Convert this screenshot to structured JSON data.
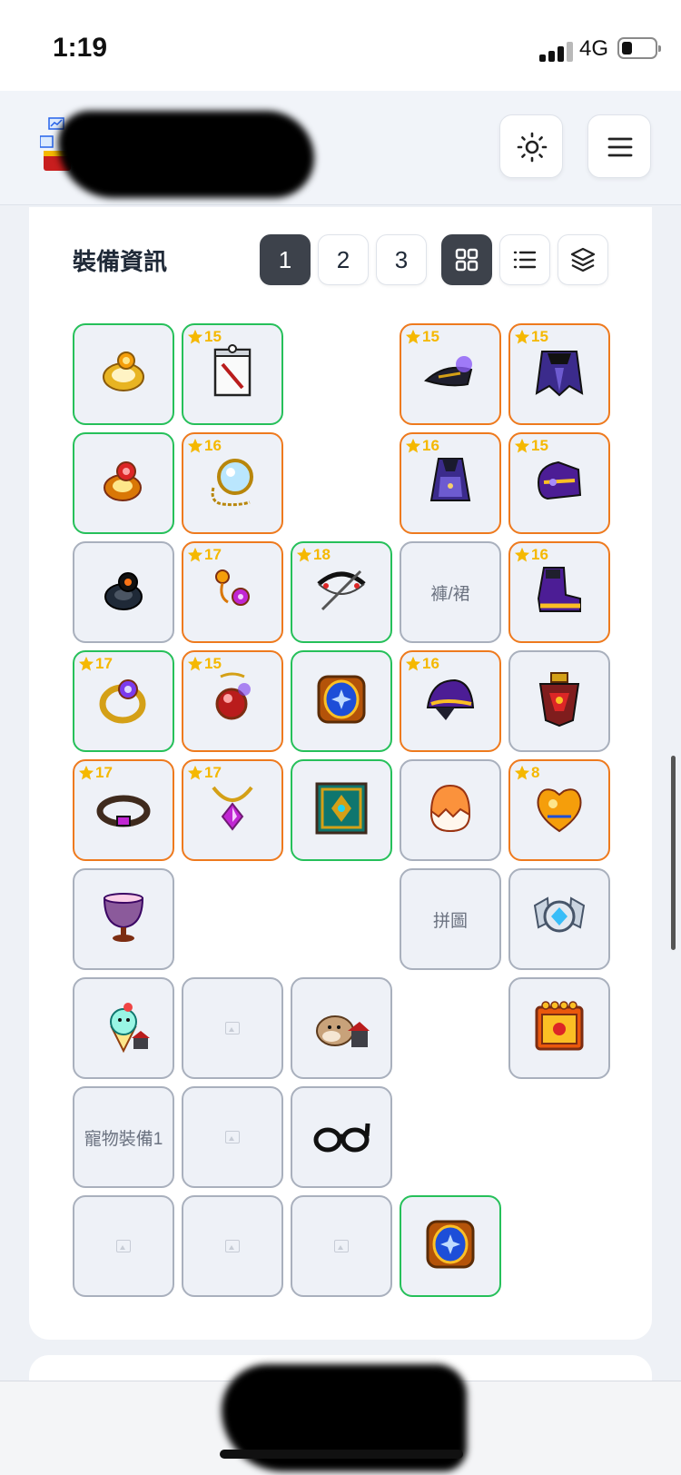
{
  "status": {
    "time": "1:19",
    "network": "4G"
  },
  "header": {
    "theme_icon": "sun-icon",
    "menu_icon": "hamburger-icon"
  },
  "equipment": {
    "title": "裝備資訊",
    "tabs": [
      "1",
      "2",
      "3"
    ],
    "active_tab": "1",
    "view_icons": [
      "grid-icon",
      "list-icon",
      "layers-icon"
    ],
    "active_view": "grid-icon"
  },
  "slots": [
    {
      "name": "ring",
      "rarity": "green",
      "stars": "",
      "icon": "gold-ring"
    },
    {
      "name": "scroll",
      "rarity": "green",
      "stars": "15",
      "icon": "scroll-paper"
    },
    {
      "name": "eye",
      "rarity": "orange",
      "stars": "15",
      "icon": "eye-accessory"
    },
    {
      "name": "cape",
      "rarity": "orange",
      "stars": "15",
      "icon": "cape"
    },
    {
      "name": "ring2",
      "rarity": "green",
      "stars": "",
      "icon": "red-ring"
    },
    {
      "name": "pendant",
      "rarity": "orange",
      "stars": "16",
      "icon": "mirror-pendant"
    },
    {
      "name": "top",
      "rarity": "orange",
      "stars": "16",
      "icon": "purple-top"
    },
    {
      "name": "glove",
      "rarity": "orange",
      "stars": "15",
      "icon": "glove"
    },
    {
      "name": "ring3",
      "rarity": "gray",
      "stars": "",
      "icon": "dark-ring"
    },
    {
      "name": "earring",
      "rarity": "orange",
      "stars": "17",
      "icon": "earring"
    },
    {
      "name": "weapon",
      "rarity": "green",
      "stars": "18",
      "icon": "bow"
    },
    {
      "name": "bottom",
      "rarity": "gray",
      "stars": "",
      "label": "褲/裙"
    },
    {
      "name": "shoes",
      "rarity": "orange",
      "stars": "16",
      "icon": "shoes"
    },
    {
      "name": "ring4",
      "rarity": "green",
      "stars": "17",
      "icon": "gem-ring"
    },
    {
      "name": "pendant2",
      "rarity": "orange",
      "stars": "15",
      "icon": "red-pendant"
    },
    {
      "name": "emblem",
      "rarity": "green",
      "stars": "",
      "icon": "blue-gem"
    },
    {
      "name": "hat",
      "rarity": "orange",
      "stars": "16",
      "icon": "hat"
    },
    {
      "name": "shoulder",
      "rarity": "gray",
      "stars": "",
      "icon": "shoulder"
    },
    {
      "name": "belt",
      "rarity": "orange",
      "stars": "17",
      "icon": "belt"
    },
    {
      "name": "necklace",
      "rarity": "orange",
      "stars": "17",
      "icon": "purple-necklace"
    },
    {
      "name": "book",
      "rarity": "green",
      "stars": "",
      "icon": "emerald-book"
    },
    {
      "name": "egg",
      "rarity": "gray",
      "stars": "",
      "icon": "egg"
    },
    {
      "name": "heart",
      "rarity": "orange",
      "stars": "8",
      "icon": "heart"
    },
    {
      "name": "pocket",
      "rarity": "gray",
      "stars": "",
      "icon": "goblet"
    },
    {
      "name": "puzzle",
      "rarity": "gray",
      "stars": "",
      "label": "拼圖"
    },
    {
      "name": "badge",
      "rarity": "gray",
      "stars": "",
      "icon": "silver-badge"
    },
    {
      "name": "pet-ice",
      "rarity": "gray",
      "stars": "",
      "icon": "ice-cream-pet"
    },
    {
      "name": "empty1",
      "rarity": "gray",
      "stars": "",
      "icon": "image-placeholder"
    },
    {
      "name": "pet-hamster",
      "rarity": "gray",
      "stars": "",
      "icon": "hamster-pet"
    },
    {
      "name": "android",
      "rarity": "gray",
      "stars": "",
      "icon": "golden-book"
    },
    {
      "name": "pet-equip",
      "rarity": "gray",
      "stars": "",
      "label": "寵物裝備1"
    },
    {
      "name": "empty2",
      "rarity": "gray",
      "stars": "",
      "icon": "image-placeholder"
    },
    {
      "name": "glasses",
      "rarity": "gray",
      "stars": "",
      "icon": "glasses"
    },
    {
      "name": "empty3",
      "rarity": "gray",
      "stars": "",
      "icon": "image-placeholder"
    },
    {
      "name": "empty4",
      "rarity": "gray",
      "stars": "",
      "icon": "image-placeholder"
    },
    {
      "name": "empty5",
      "rarity": "gray",
      "stars": "",
      "icon": "image-placeholder"
    },
    {
      "name": "emblem2",
      "rarity": "green",
      "stars": "",
      "icon": "blue-gem"
    }
  ],
  "colors": {
    "green": "#26c05a",
    "orange": "#ee7a1e",
    "gray": "#a9b0bd",
    "star": "#f5b800",
    "active": "#3d424b"
  }
}
